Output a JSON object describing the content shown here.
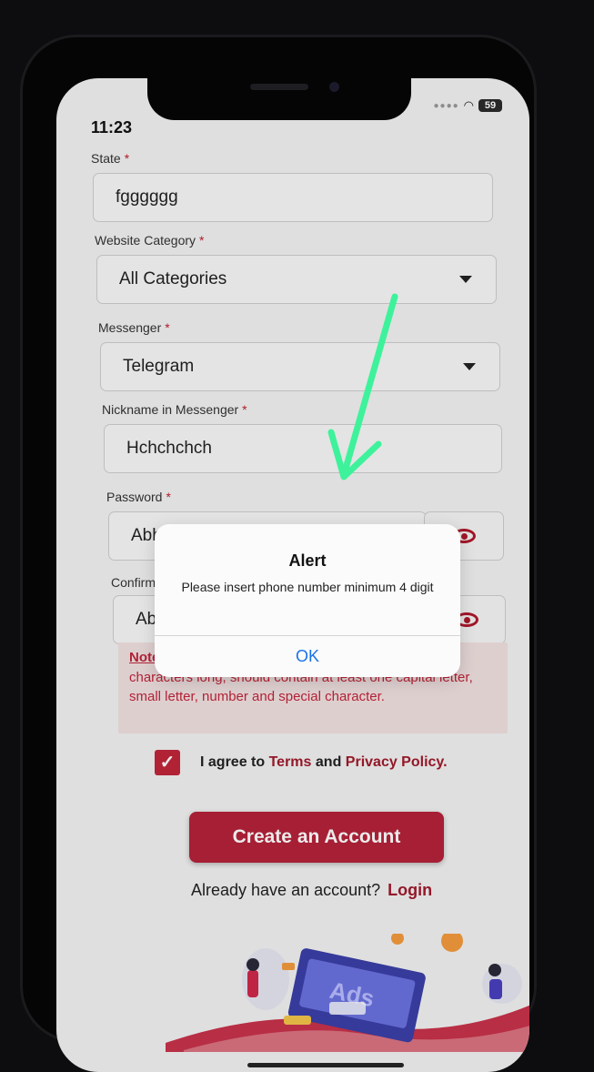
{
  "status_bar": {
    "time": "11:23",
    "battery": "59"
  },
  "form": {
    "state": {
      "label": "State",
      "required": "*",
      "value": "fgggggg"
    },
    "website_category": {
      "label": "Website Category",
      "required": "*",
      "value": "All Categories"
    },
    "messenger": {
      "label": "Messenger",
      "required": "*",
      "value": "Telegram"
    },
    "nickname": {
      "label": "Nickname in Messenger",
      "required": "*",
      "value": "Hchchchch"
    },
    "password": {
      "label": "Password",
      "required": "*",
      "value": "Abhinav@123"
    },
    "confirm_password": {
      "label": "Confirm",
      "value": "Ab"
    }
  },
  "note": {
    "heading": "Note",
    "text": "characters long, should contain at least one capital letter, small letter, number and special character."
  },
  "agree": {
    "prefix": "I agree to",
    "terms": "Terms",
    "and": "and",
    "privacy": "Privacy Policy."
  },
  "create_button": "Create an Account",
  "login_prompt": {
    "text": "Already have an account?",
    "link": "Login"
  },
  "alert": {
    "title": "Alert",
    "message": "Please insert phone number minimum 4 digit",
    "ok": "OK"
  },
  "illustration_text": "Ads",
  "colors": {
    "brand": "#b5223a",
    "link_blue": "#1a73e8",
    "arrow": "#3ef29b"
  }
}
